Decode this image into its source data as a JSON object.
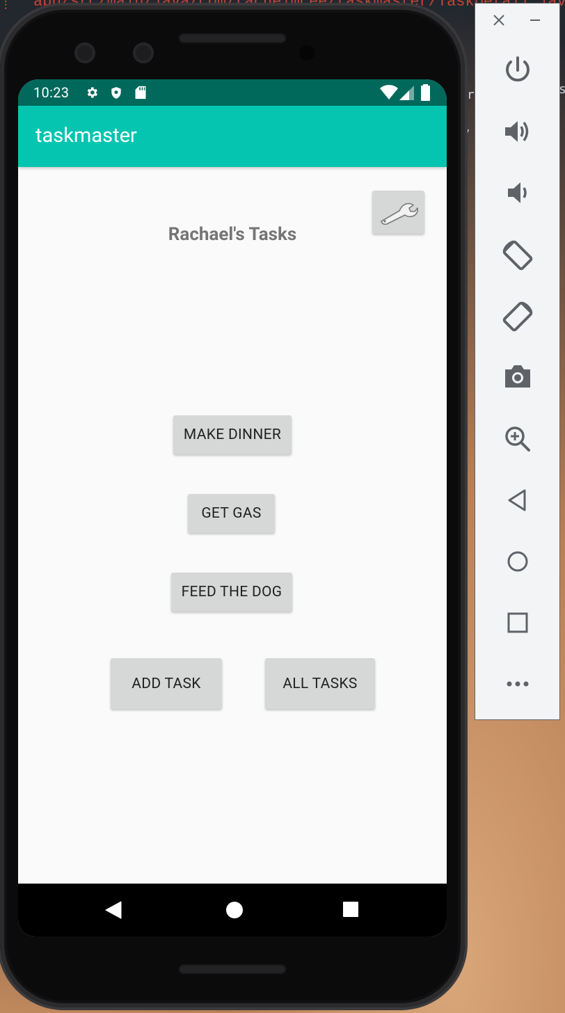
{
  "desktop": {
    "code_path": "app/src/main/java/com/rachelmcee/taskmaster/TaskDetail.java",
    "side_texts": [
      "s",
      ")r",
      "y"
    ]
  },
  "device": {
    "status_bar": {
      "time": "10:23",
      "left_icons": [
        "gear-icon",
        "shield-icon",
        "sd-card-icon"
      ],
      "right_icons": [
        "wifi-icon",
        "signal-icon",
        "battery-icon"
      ]
    },
    "app_bar": {
      "title": "taskmaster"
    },
    "main": {
      "settings_icon": "wrench-icon",
      "heading": "Rachael's Tasks",
      "task_buttons": [
        "MAKE DINNER",
        "GET GAS",
        "FEED THE DOG"
      ],
      "add_task_label": "ADD TASK",
      "all_tasks_label": "ALL TASKS"
    },
    "nav_bar": [
      "back-icon",
      "home-icon",
      "recents-icon"
    ]
  },
  "emulator_toolbar": {
    "window_controls": [
      "close-icon",
      "minimize-icon"
    ],
    "tools": [
      "power-icon",
      "volume-up-icon",
      "volume-down-icon",
      "rotate-left-icon",
      "rotate-right-icon",
      "camera-icon",
      "zoom-icon",
      "back-icon",
      "home-icon",
      "overview-icon",
      "more-icon"
    ]
  },
  "colors": {
    "status_bar": "#00695c",
    "app_bar": "#06c5b0",
    "button": "#d6d7d7",
    "heading_text": "#757575",
    "toolbar_icon": "#5f6368"
  }
}
